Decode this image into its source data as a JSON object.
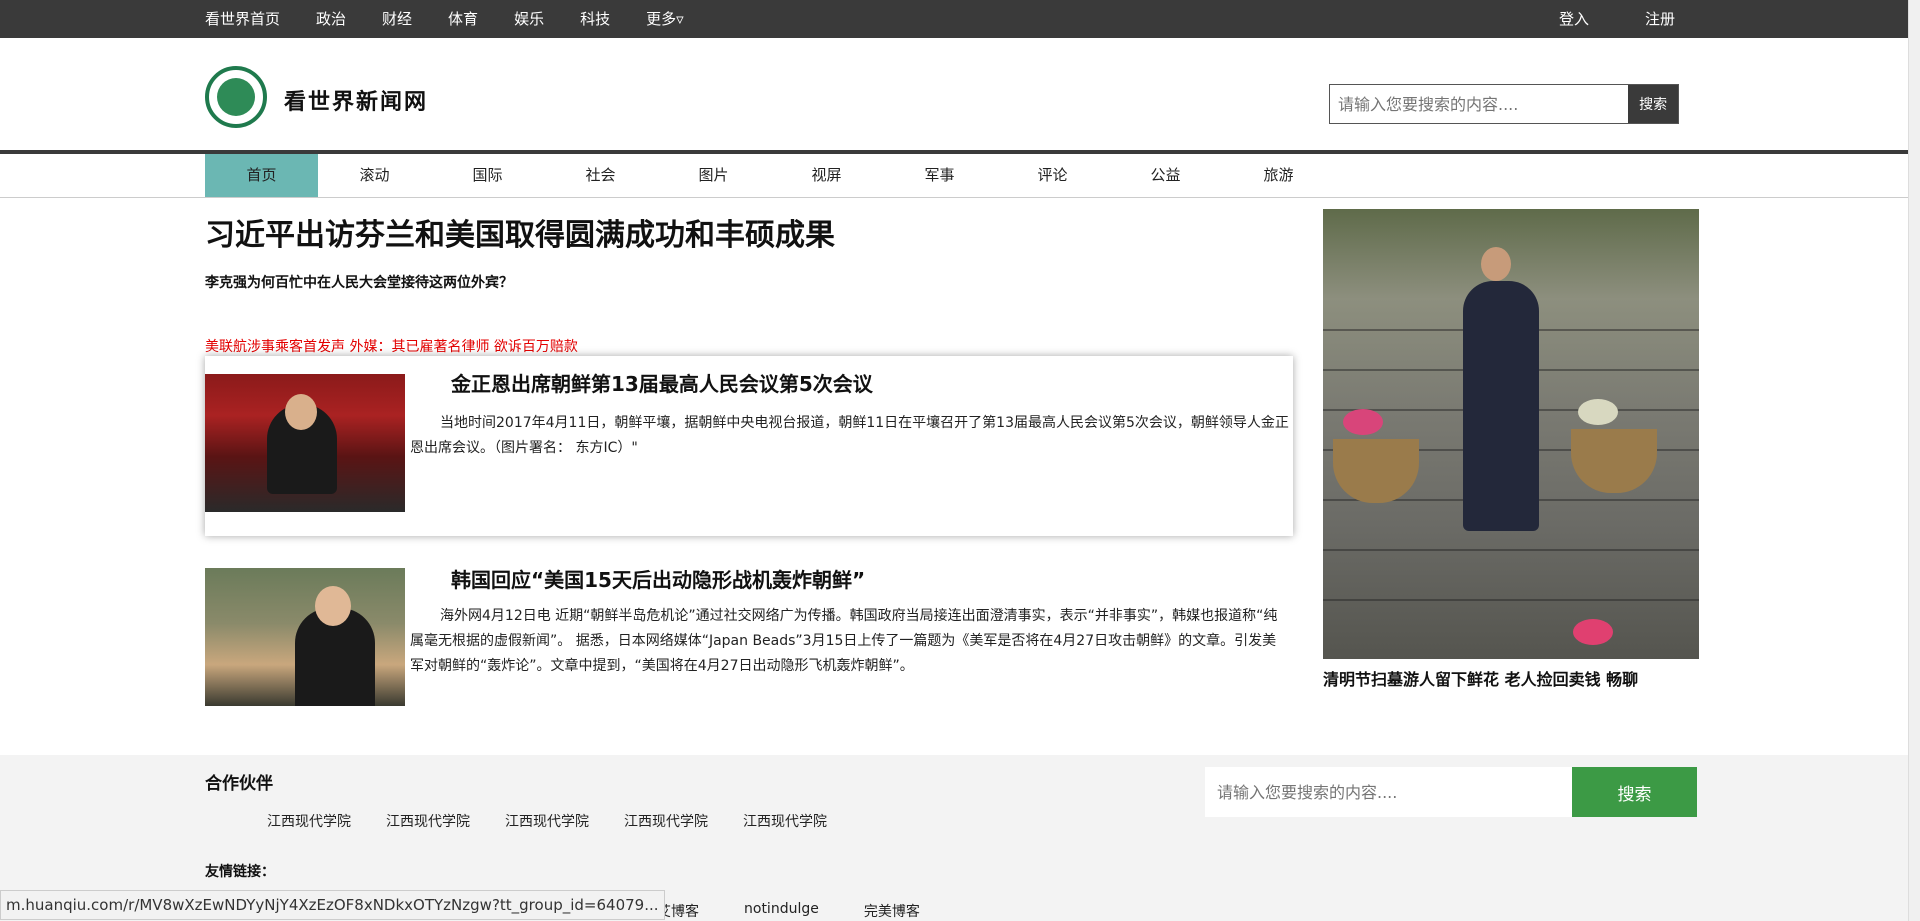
{
  "topbar": {
    "nav": [
      "看世界首页",
      "政治",
      "财经",
      "体育",
      "娱乐",
      "科技",
      "更多▿"
    ],
    "login": "登入",
    "register": "注册"
  },
  "header": {
    "site_name": "看世界新闻网",
    "search_placeholder": "请输入您要搜索的内容....",
    "search_button": "搜索"
  },
  "channels": [
    {
      "label": "首页",
      "active": true
    },
    {
      "label": "滚动"
    },
    {
      "label": "国际"
    },
    {
      "label": "社会"
    },
    {
      "label": "图片"
    },
    {
      "label": "视屏"
    },
    {
      "label": "军事"
    },
    {
      "label": "评论"
    },
    {
      "label": "公益"
    },
    {
      "label": "旅游"
    }
  ],
  "main": {
    "headline": "习近平出访芬兰和美国取得圆满成功和丰硕成果",
    "subline": "李克强为何百忙中在人民大会堂接待这两位外宾？",
    "redline": "美联航涉事乘客首发声 外媒：其已雇著名律师 欲诉百万赔款",
    "articles": [
      {
        "title": "金正恩出席朝鲜第13届最高人民会议第5次会议",
        "body": "当地时间2017年4月11日，朝鲜平壤，据朝鲜中央电视台报道，朝鲜11日在平壤召开了第13届最高人民会议第5次会议，朝鲜领导人金正恩出席会议。（图片署名： 东方IC）\""
      },
      {
        "title": "韩国回应“美国15天后出动隐形战机轰炸朝鲜”",
        "body": "海外网4月12日电 近期“朝鲜半岛危机论”通过社交网络广为传播。韩国政府当局接连出面澄清事实，表示“并非事实”，韩媒也报道称“纯属毫无根据的虚假新闻”。 据悉，日本网络媒体“Japan Beads”3月15日上传了一篇题为《美军是否将在4月27日攻击朝鲜》的文章。引发美军对朝鲜的“轰炸论”。文章中提到，“美国将在4月27日出动隐形飞机轰炸朝鲜”。"
      }
    ]
  },
  "side": {
    "caption": "清明节扫墓游人留下鲜花 老人捡回卖钱 畅聊"
  },
  "footer": {
    "partners_title": "合作伙伴",
    "partners": [
      "江西现代学院",
      "江西现代学院",
      "江西现代学院",
      "江西现代学院",
      "江西现代学院"
    ],
    "search_placeholder": "请输入您要搜索的内容....",
    "search_button": "搜索",
    "links_title": "友情链接：",
    "links": [
      "小艾博客",
      "notindulge",
      "完美博客"
    ]
  },
  "statusbar": {
    "url": "m.huanqiu.com/r/MV8wXzEwNDYyNjY4XzEzOF8xNDkxOTYzNzgw?tt_group_id=64079..."
  }
}
